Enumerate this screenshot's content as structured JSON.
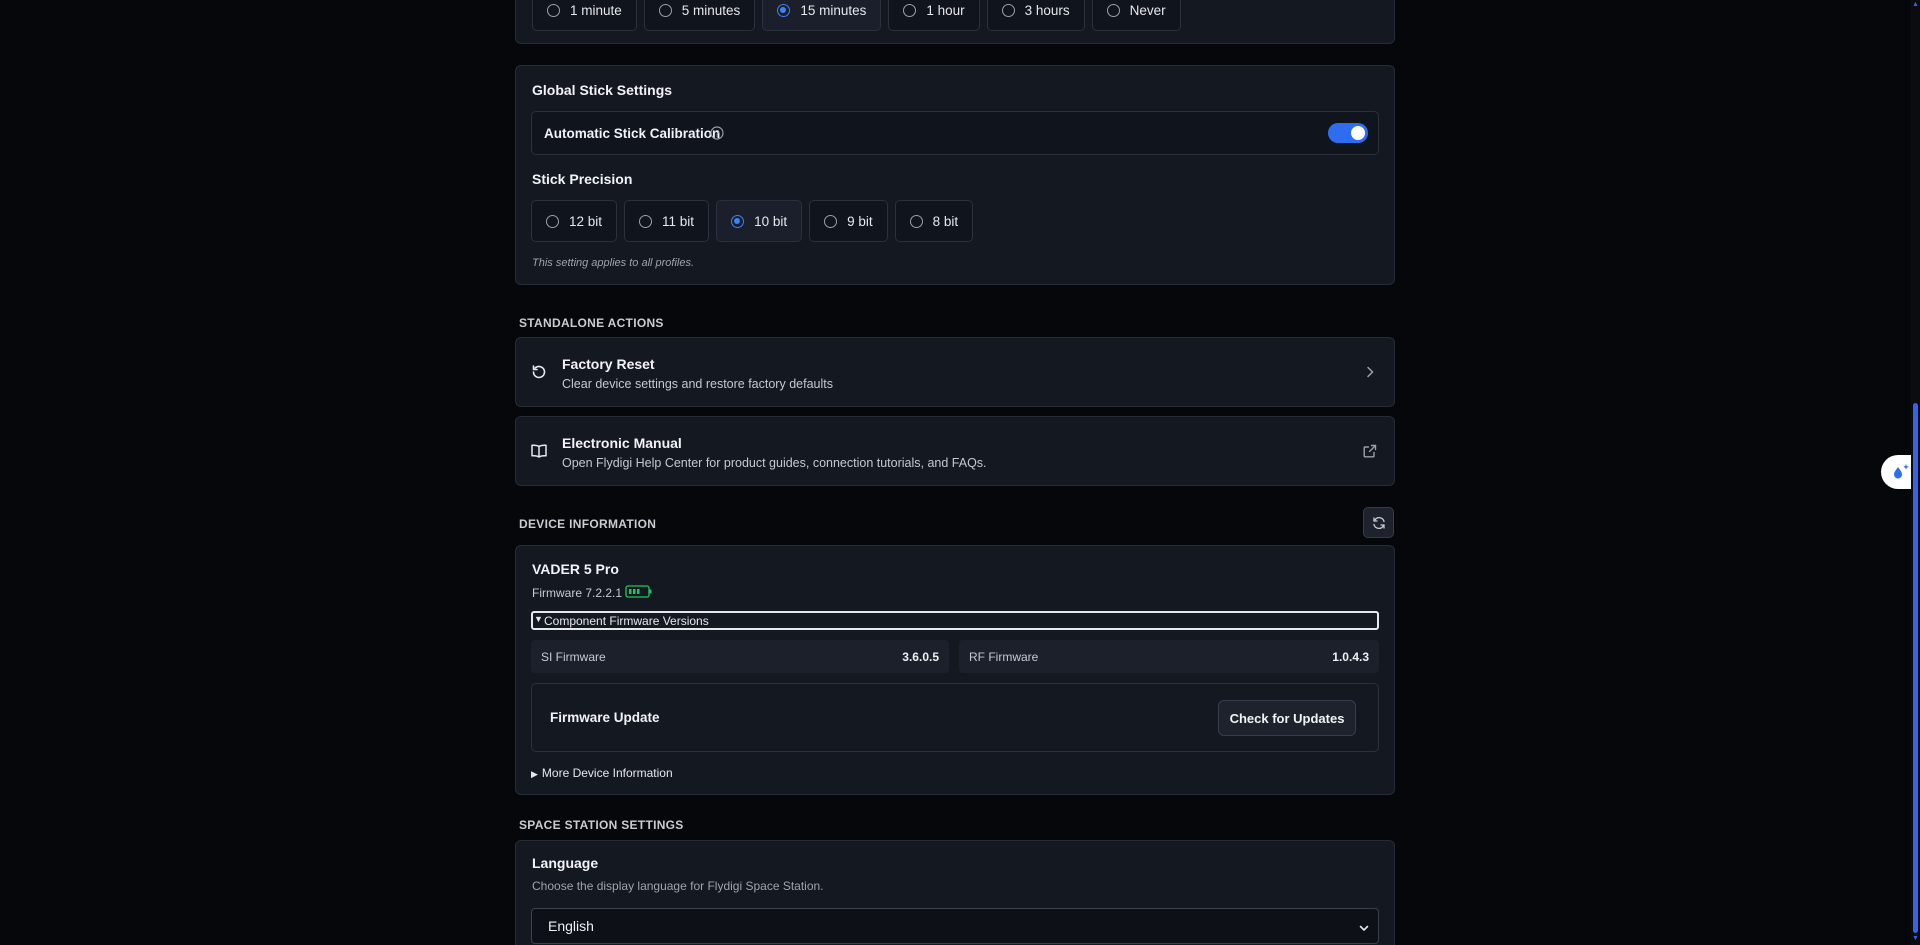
{
  "timeout": {
    "options": [
      "1 minute",
      "5 minutes",
      "15 minutes",
      "1 hour",
      "3 hours",
      "Never"
    ],
    "selected": "15 minutes"
  },
  "global_stick": {
    "title": "Global Stick Settings",
    "auto_calibration_label": "Automatic Stick Calibration",
    "auto_calibration_enabled": true,
    "precision_title": "Stick Precision",
    "precision_options": [
      "12 bit",
      "11 bit",
      "10 bit",
      "9 bit",
      "8 bit"
    ],
    "precision_selected": "10 bit",
    "note": "This setting applies to all profiles."
  },
  "standalone_actions": {
    "header": "STANDALONE ACTIONS",
    "factory_reset": {
      "title": "Factory Reset",
      "subtitle": "Clear device settings and restore factory defaults"
    },
    "manual": {
      "title": "Electronic Manual",
      "subtitle": "Open Flydigi Help Center for product guides, connection tutorials, and FAQs."
    }
  },
  "device_info": {
    "header": "DEVICE INFORMATION",
    "device_name": "VADER 5 Pro",
    "firmware": "Firmware 7.2.2.1",
    "component_toggle": "Component Firmware Versions",
    "si_label": "SI Firmware",
    "si_value": "3.6.0.5",
    "rf_label": "RF Firmware",
    "rf_value": "1.0.4.3",
    "update_title": "Firmware Update",
    "update_button": "Check for Updates",
    "more_info": "More Device Information"
  },
  "space_station": {
    "header": "SPACE STATION SETTINGS",
    "language_title": "Language",
    "language_desc": "Choose the display language for Flydigi Space Station.",
    "language_value": "English"
  },
  "colors": {
    "accent": "#3b82f6",
    "battery": "#22c55e"
  }
}
